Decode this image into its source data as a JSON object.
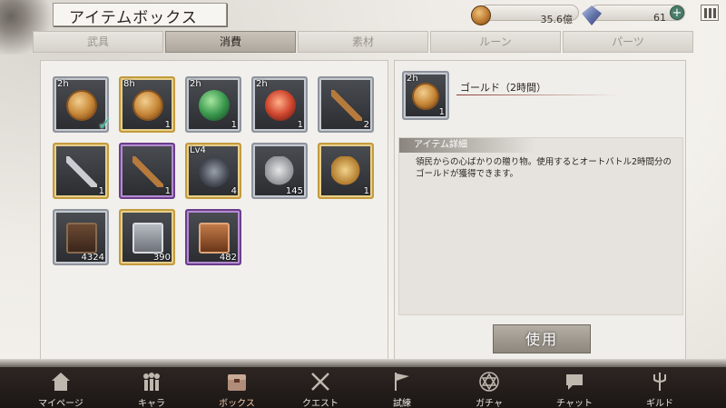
{
  "header": {
    "title": "アイテムボックス",
    "coins": "35.6億",
    "gems": "61",
    "plus_label": "+"
  },
  "tabs": [
    {
      "label": "武具",
      "active": false
    },
    {
      "label": "消費",
      "active": true
    },
    {
      "label": "素材",
      "active": false
    },
    {
      "label": "ルーン",
      "active": false
    },
    {
      "label": "パーツ",
      "active": false
    }
  ],
  "items": [
    {
      "badge": "2h",
      "count": "",
      "art": "coin",
      "frame": "silver",
      "selected": true
    },
    {
      "badge": "8h",
      "count": "1",
      "art": "coin",
      "frame": "gold"
    },
    {
      "badge": "2h",
      "count": "1",
      "art": "orb-green",
      "frame": "silver"
    },
    {
      "badge": "2h",
      "count": "1",
      "art": "orb-red",
      "frame": "silver"
    },
    {
      "badge": "",
      "count": "2",
      "art": "key-bronze",
      "frame": "silver"
    },
    {
      "badge": "",
      "count": "1",
      "art": "key-silver",
      "frame": "gold"
    },
    {
      "badge": "",
      "count": "1",
      "art": "key-bronze",
      "frame": "purple"
    },
    {
      "badge": "Lv4",
      "count": "4",
      "art": "emblem",
      "frame": "gold"
    },
    {
      "badge": "",
      "count": "145",
      "art": "scrap-silver",
      "frame": "silver"
    },
    {
      "badge": "",
      "count": "1",
      "art": "scrap-gold",
      "frame": "gold"
    },
    {
      "badge": "",
      "count": "4324",
      "art": "chest-dark",
      "frame": "silver"
    },
    {
      "badge": "",
      "count": "390",
      "art": "chest-silver",
      "frame": "gold"
    },
    {
      "badge": "",
      "count": "482",
      "art": "chest-copper",
      "frame": "purple"
    }
  ],
  "detail": {
    "badge": "2h",
    "count": "1",
    "name": "ゴールド（2時間）",
    "section_title": "アイテム詳細",
    "description": "領民からの心ばかりの贈り物。使用するとオートバトル2時間分のゴールドが獲得できます。",
    "use_label": "使用"
  },
  "nav": [
    {
      "label": "マイページ",
      "icon": "home-icon",
      "active": false
    },
    {
      "label": "キャラ",
      "icon": "characters-icon",
      "active": false
    },
    {
      "label": "ボックス",
      "icon": "box-icon",
      "active": true
    },
    {
      "label": "クエスト",
      "icon": "crossed-swords-icon",
      "active": false
    },
    {
      "label": "試練",
      "icon": "flag-icon",
      "active": false
    },
    {
      "label": "ガチャ",
      "icon": "hexagram-icon",
      "active": false
    },
    {
      "label": "チャット",
      "icon": "chat-icon",
      "active": false
    },
    {
      "label": "ギルド",
      "icon": "trident-icon",
      "active": false
    }
  ],
  "colors": {
    "accent": "#8a3b33",
    "check": "#3fb89a",
    "gold_frame": "#c39b3f",
    "purple_frame": "#6a3e8c"
  }
}
